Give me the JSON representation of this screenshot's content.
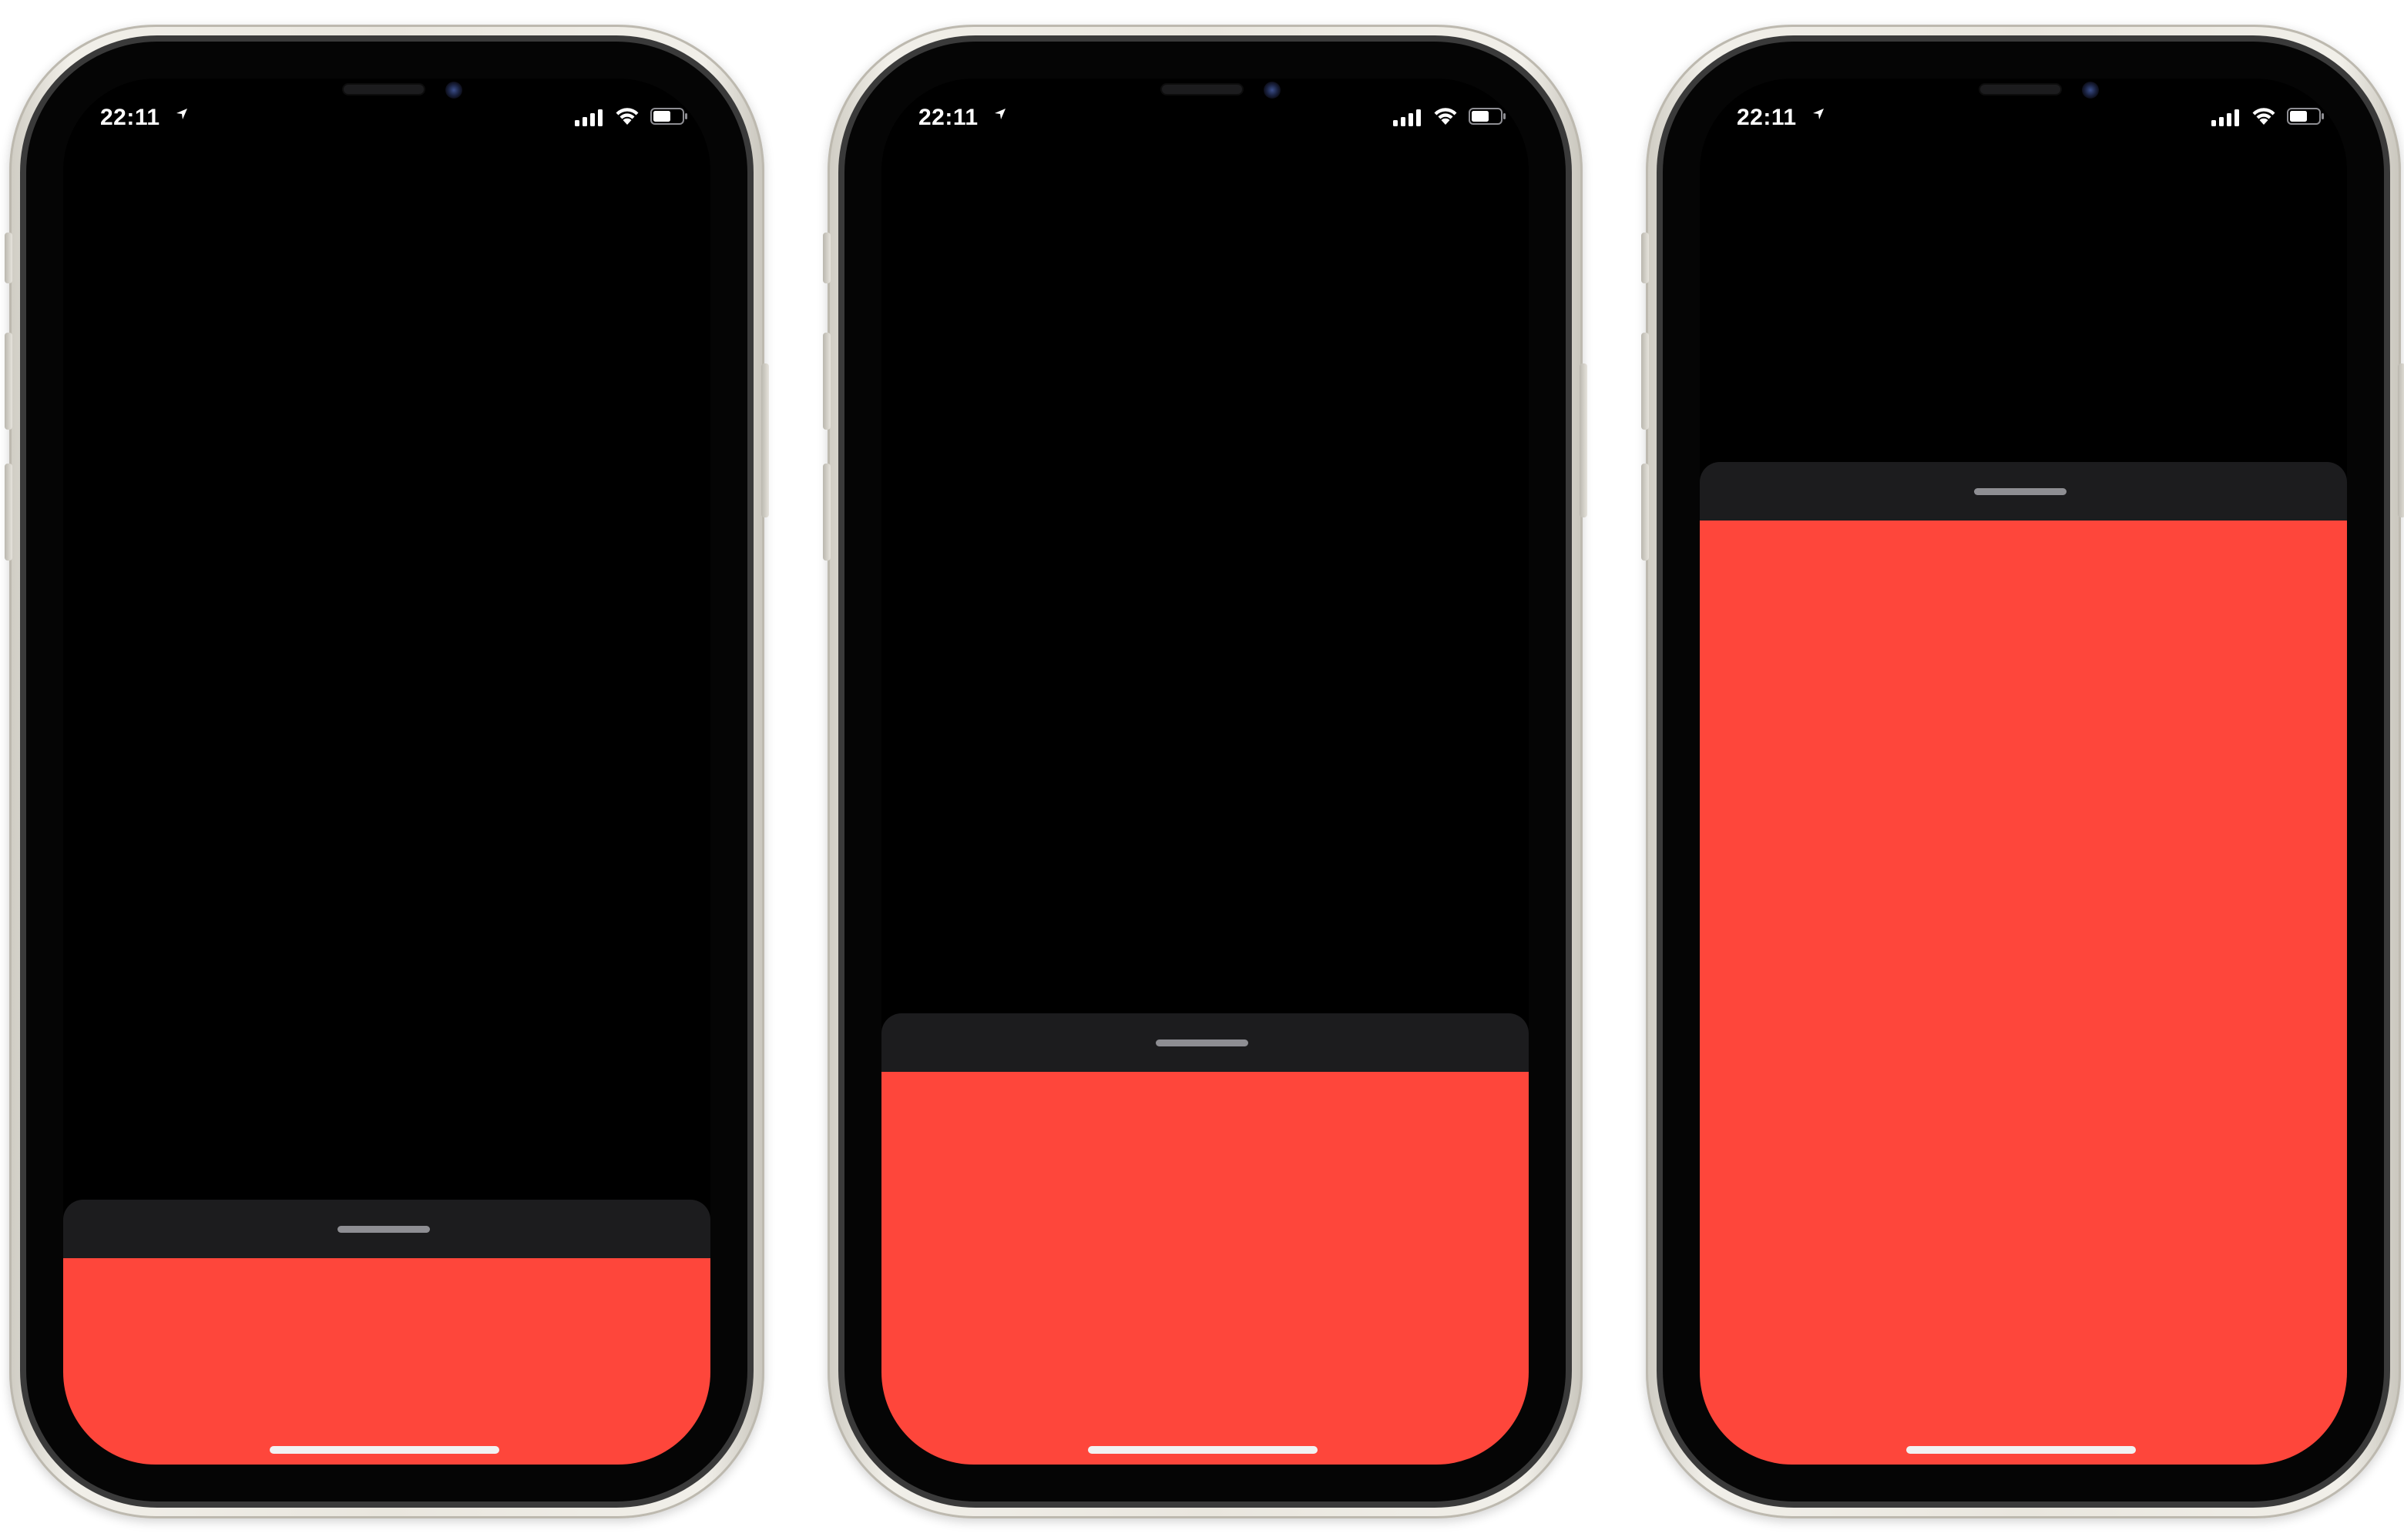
{
  "colors": {
    "screen_background": "#000000",
    "sheet_header": "#1c1c1e",
    "sheet_body": "#fe463b",
    "grabber": "#8e8e93",
    "home_indicator": "#f2f2f2",
    "status_text": "#ffffff"
  },
  "icons": {
    "location": "location-arrow-icon",
    "signal": "cellular-signal-icon",
    "wifi": "wifi-icon",
    "battery": "battery-icon"
  },
  "phones": [
    {
      "status_bar": {
        "time": "22:11"
      },
      "sheet": {
        "state": "collapsed"
      }
    },
    {
      "status_bar": {
        "time": "22:11"
      },
      "sheet": {
        "state": "medium"
      }
    },
    {
      "status_bar": {
        "time": "22:11"
      },
      "sheet": {
        "state": "expanded"
      }
    }
  ]
}
